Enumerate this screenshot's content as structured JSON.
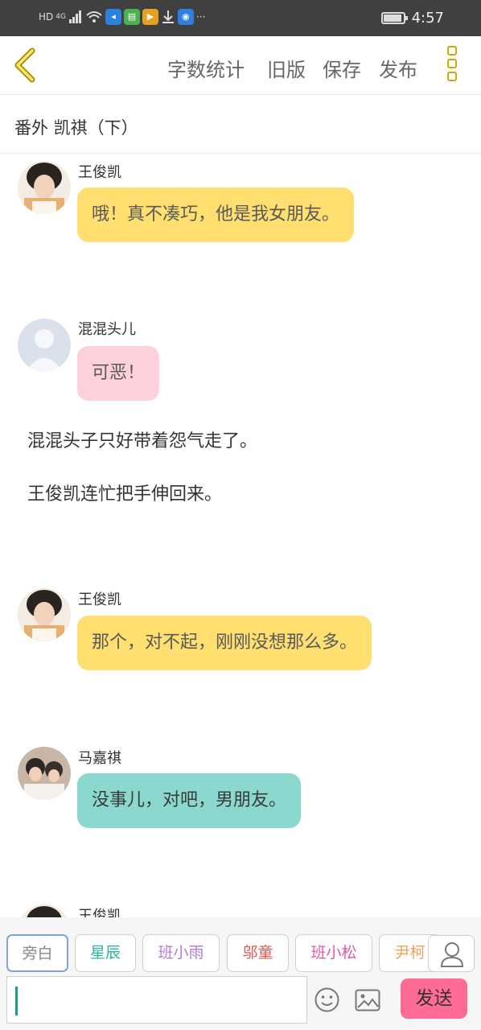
{
  "status_bar": {
    "network_hd": "HD",
    "network_4g": "4G",
    "dots": "···",
    "time": "4:57"
  },
  "toolbar": {
    "word_count_label": "字数统计",
    "old_version_label": "旧版",
    "save_label": "保存",
    "publish_label": "发布"
  },
  "chapter": {
    "title": "番外   凯祺（下）"
  },
  "messages": [
    {
      "type": "bubble",
      "speaker": "王俊凯",
      "text": "哦！真不凑巧，他是我女朋友。",
      "color": "#fedf70"
    },
    {
      "type": "bubble",
      "speaker": "混混头儿",
      "text": "可恶！",
      "color": "#fdd1dc"
    },
    {
      "type": "narration",
      "text": "混混头子只好带着怨气走了。"
    },
    {
      "type": "narration",
      "text": "王俊凯连忙把手伸回来。"
    },
    {
      "type": "bubble",
      "speaker": "王俊凯",
      "text": "那个，对不起，刚刚没想那么多。",
      "color": "#fedf70"
    },
    {
      "type": "bubble",
      "speaker": "马嘉祺",
      "text": "没事儿，对吧，男朋友。",
      "color": "#8bd8cf"
    },
    {
      "type": "bubble",
      "speaker": "王俊凯",
      "text": "",
      "color": "#fedf70"
    }
  ],
  "roles": [
    {
      "label": "旁白",
      "color": "#888888"
    },
    {
      "label": "星辰",
      "color": "#2bb3a0"
    },
    {
      "label": "班小雨",
      "color": "#b57ad6"
    },
    {
      "label": "邬童",
      "color": "#e0584f"
    },
    {
      "label": "班小松",
      "color": "#e05aa0"
    },
    {
      "label": "尹柯",
      "color": "#f0a35a"
    }
  ],
  "composer": {
    "input_value": "",
    "send_label": "发送"
  }
}
